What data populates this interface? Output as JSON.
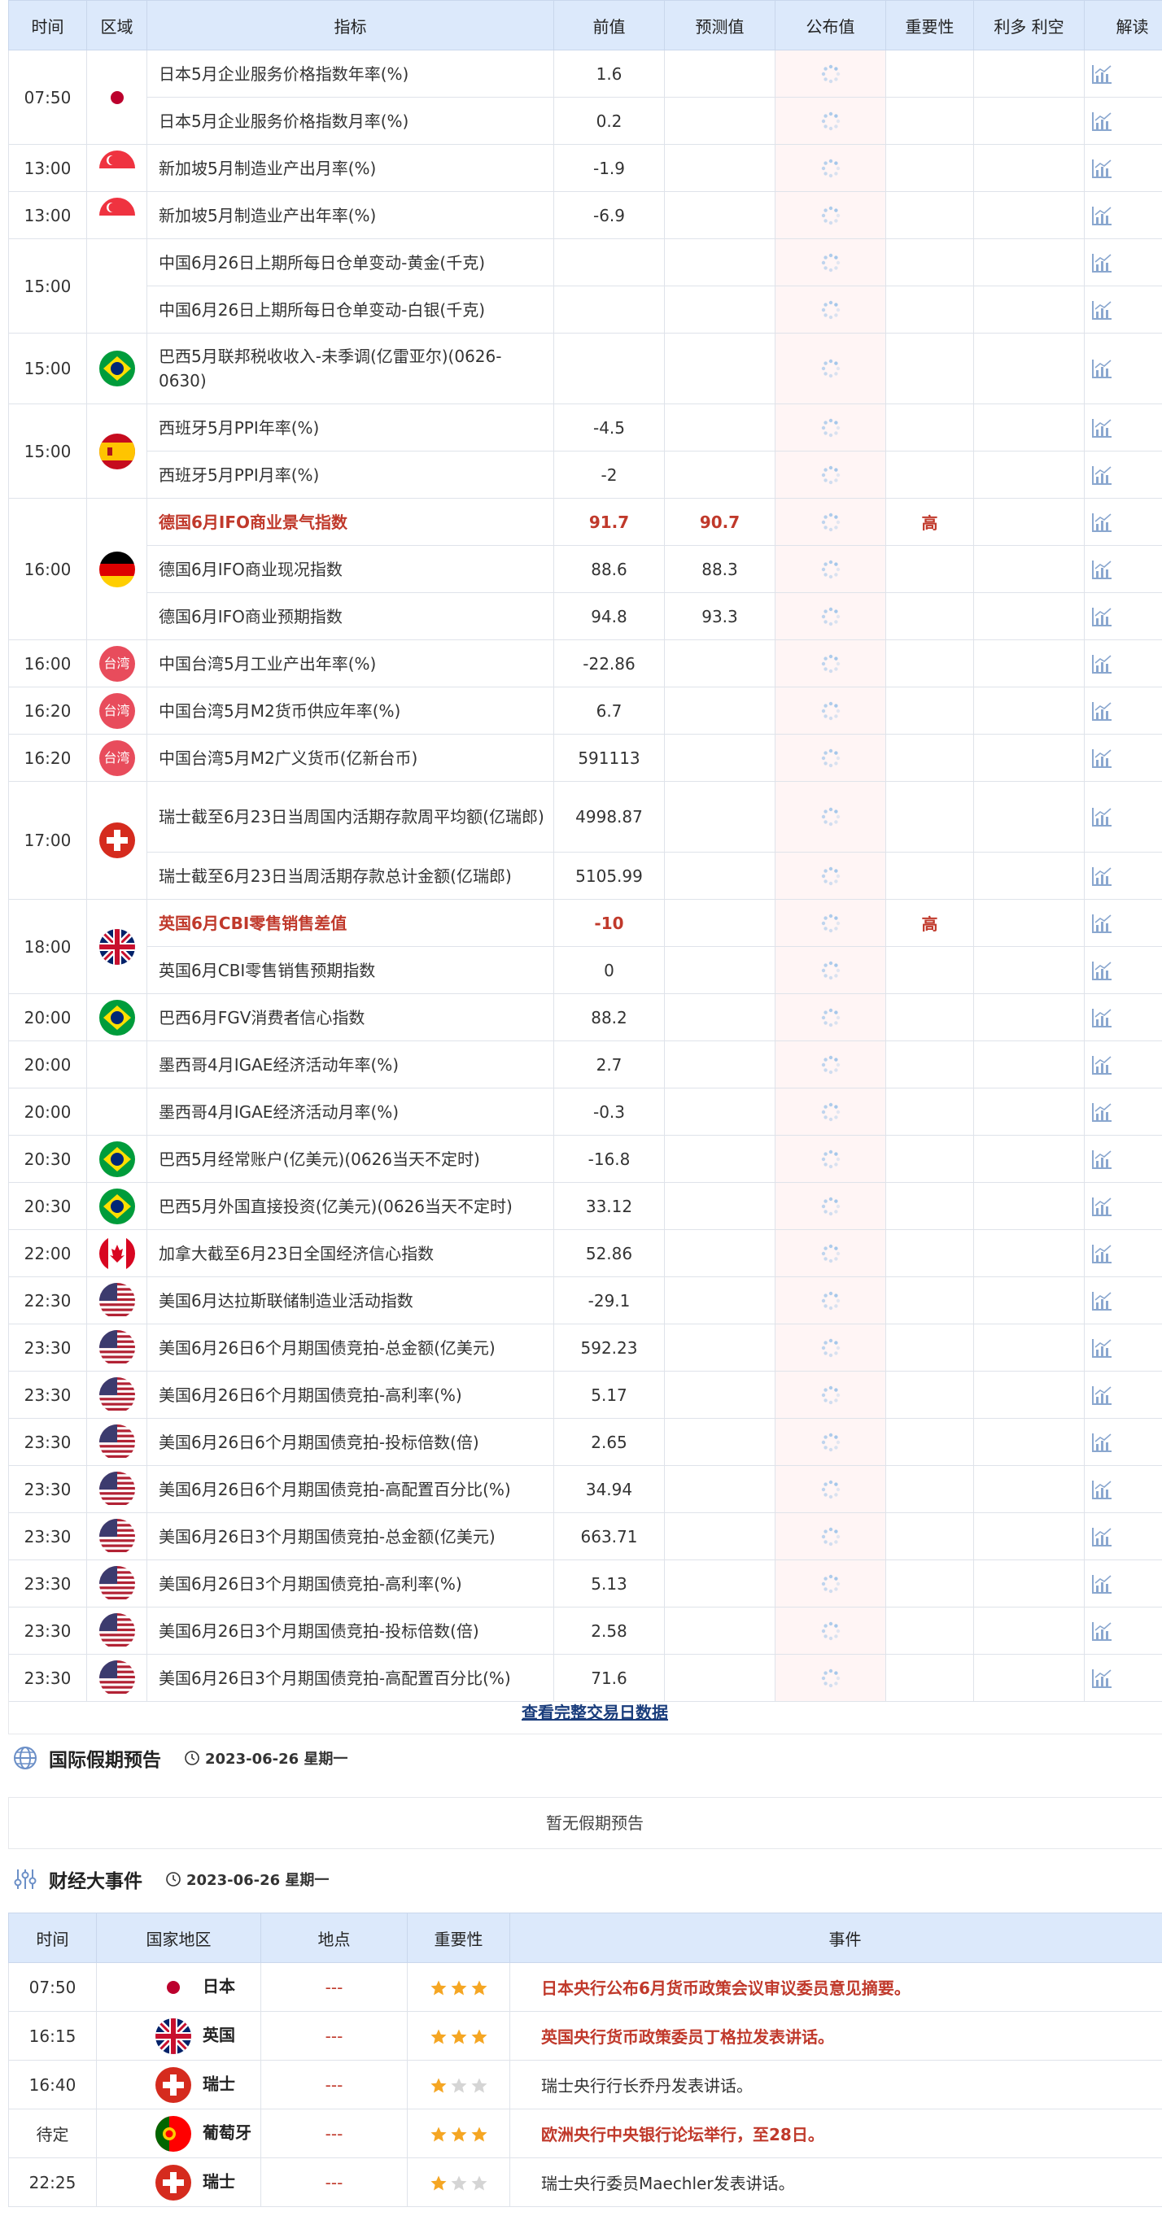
{
  "headers": {
    "time": "时间",
    "area": "区域",
    "indicator": "指标",
    "prev": "前值",
    "forecast": "预测值",
    "actual": "公布值",
    "importance": "重要性",
    "effect": "利多 利空",
    "explain": "解读"
  },
  "rows": [
    {
      "time": "07:50",
      "flag": "jp",
      "indicator": "日本5月企业服务价格指数年率(%)",
      "prev": "1.6",
      "forecast": "",
      "importance": "",
      "hl": false
    },
    {
      "time": "",
      "flag": "",
      "indicator": "日本5月企业服务价格指数月率(%)",
      "prev": "0.2",
      "forecast": "",
      "importance": "",
      "hl": false
    },
    {
      "time": "13:00",
      "flag": "sg",
      "indicator": "新加坡5月制造业产出月率(%)",
      "prev": "-1.9",
      "forecast": "",
      "importance": "",
      "hl": false
    },
    {
      "time": "13:00",
      "flag": "sg",
      "indicator": "新加坡5月制造业产出年率(%)",
      "prev": "-6.9",
      "forecast": "",
      "importance": "",
      "hl": false
    },
    {
      "time": "15:00",
      "flag": "none",
      "indicator": "中国6月26日上期所每日仓单变动-黄金(千克)",
      "prev": "",
      "forecast": "",
      "importance": "",
      "hl": false
    },
    {
      "time": "",
      "flag": "",
      "indicator": "中国6月26日上期所每日仓单变动-白银(千克)",
      "prev": "",
      "forecast": "",
      "importance": "",
      "hl": false
    },
    {
      "time": "15:00",
      "flag": "br",
      "indicator": "巴西5月联邦税收收入-未季调(亿雷亚尔)(0626-0630)",
      "prev": "",
      "forecast": "",
      "importance": "",
      "hl": false,
      "tall": true
    },
    {
      "time": "15:00",
      "flag": "es",
      "indicator": "西班牙5月PPI年率(%)",
      "prev": "-4.5",
      "forecast": "",
      "importance": "",
      "hl": false
    },
    {
      "time": "",
      "flag": "",
      "indicator": "西班牙5月PPI月率(%)",
      "prev": "-2",
      "forecast": "",
      "importance": "",
      "hl": false
    },
    {
      "time": "16:00",
      "flag": "de",
      "indicator": "德国6月IFO商业景气指数",
      "prev": "91.7",
      "forecast": "90.7",
      "importance": "高",
      "hl": true
    },
    {
      "time": "",
      "flag": "",
      "indicator": "德国6月IFO商业现况指数",
      "prev": "88.6",
      "forecast": "88.3",
      "importance": "",
      "hl": false
    },
    {
      "time": "",
      "flag": "",
      "indicator": "德国6月IFO商业预期指数",
      "prev": "94.8",
      "forecast": "93.3",
      "importance": "",
      "hl": false
    },
    {
      "time": "16:00",
      "flag": "tw",
      "indicator": "中国台湾5月工业产出年率(%)",
      "prev": "-22.86",
      "forecast": "",
      "importance": "",
      "hl": false
    },
    {
      "time": "16:20",
      "flag": "tw",
      "indicator": "中国台湾5月M2货币供应年率(%)",
      "prev": "6.7",
      "forecast": "",
      "importance": "",
      "hl": false
    },
    {
      "time": "16:20",
      "flag": "tw",
      "indicator": "中国台湾5月M2广义货币(亿新台币)",
      "prev": "591113",
      "forecast": "",
      "importance": "",
      "hl": false
    },
    {
      "time": "17:00",
      "flag": "ch",
      "indicator": "瑞士截至6月23日当周国内活期存款周平均额(亿瑞郎)",
      "prev": "4998.87",
      "forecast": "",
      "importance": "",
      "hl": false,
      "tall": true
    },
    {
      "time": "",
      "flag": "",
      "indicator": "瑞士截至6月23日当周活期存款总计金额(亿瑞郎)",
      "prev": "5105.99",
      "forecast": "",
      "importance": "",
      "hl": false
    },
    {
      "time": "18:00",
      "flag": "gb",
      "indicator": "英国6月CBI零售销售差值",
      "prev": "-10",
      "forecast": "",
      "importance": "高",
      "hl": true
    },
    {
      "time": "",
      "flag": "",
      "indicator": "英国6月CBI零售销售预期指数",
      "prev": "0",
      "forecast": "",
      "importance": "",
      "hl": false
    },
    {
      "time": "20:00",
      "flag": "br",
      "indicator": "巴西6月FGV消费者信心指数",
      "prev": "88.2",
      "forecast": "",
      "importance": "",
      "hl": false
    },
    {
      "time": "20:00",
      "flag": "none",
      "indicator": "墨西哥4月IGAE经济活动年率(%)",
      "prev": "2.7",
      "forecast": "",
      "importance": "",
      "hl": false
    },
    {
      "time": "20:00",
      "flag": "none",
      "indicator": "墨西哥4月IGAE经济活动月率(%)",
      "prev": "-0.3",
      "forecast": "",
      "importance": "",
      "hl": false
    },
    {
      "time": "20:30",
      "flag": "br",
      "indicator": "巴西5月经常账户(亿美元)(0626当天不定时)",
      "prev": "-16.8",
      "forecast": "",
      "importance": "",
      "hl": false
    },
    {
      "time": "20:30",
      "flag": "br",
      "indicator": "巴西5月外国直接投资(亿美元)(0626当天不定时)",
      "prev": "33.12",
      "forecast": "",
      "importance": "",
      "hl": false
    },
    {
      "time": "22:00",
      "flag": "ca",
      "indicator": "加拿大截至6月23日全国经济信心指数",
      "prev": "52.86",
      "forecast": "",
      "importance": "",
      "hl": false
    },
    {
      "time": "22:30",
      "flag": "us",
      "indicator": "美国6月达拉斯联储制造业活动指数",
      "prev": "-29.1",
      "forecast": "",
      "importance": "",
      "hl": false
    },
    {
      "time": "23:30",
      "flag": "us",
      "indicator": "美国6月26日6个月期国债竞拍-总金额(亿美元)",
      "prev": "592.23",
      "forecast": "",
      "importance": "",
      "hl": false
    },
    {
      "time": "23:30",
      "flag": "us",
      "indicator": "美国6月26日6个月期国债竞拍-高利率(%)",
      "prev": "5.17",
      "forecast": "",
      "importance": "",
      "hl": false
    },
    {
      "time": "23:30",
      "flag": "us",
      "indicator": "美国6月26日6个月期国债竞拍-投标倍数(倍)",
      "prev": "2.65",
      "forecast": "",
      "importance": "",
      "hl": false
    },
    {
      "time": "23:30",
      "flag": "us",
      "indicator": "美国6月26日6个月期国债竞拍-高配置百分比(%)",
      "prev": "34.94",
      "forecast": "",
      "importance": "",
      "hl": false
    },
    {
      "time": "23:30",
      "flag": "us",
      "indicator": "美国6月26日3个月期国债竞拍-总金额(亿美元)",
      "prev": "663.71",
      "forecast": "",
      "importance": "",
      "hl": false
    },
    {
      "time": "23:30",
      "flag": "us",
      "indicator": "美国6月26日3个月期国债竞拍-高利率(%)",
      "prev": "5.13",
      "forecast": "",
      "importance": "",
      "hl": false
    },
    {
      "time": "23:30",
      "flag": "us",
      "indicator": "美国6月26日3个月期国债竞拍-投标倍数(倍)",
      "prev": "2.58",
      "forecast": "",
      "importance": "",
      "hl": false
    },
    {
      "time": "23:30",
      "flag": "us",
      "indicator": "美国6月26日3个月期国债竞拍-高配置百分比(%)",
      "prev": "71.6",
      "forecast": "",
      "importance": "",
      "hl": false
    }
  ],
  "view_more": "查看完整交易日数据",
  "holiday": {
    "title": "国际假期预告",
    "date": "2023-06-26 星期一",
    "empty": "暂无假期预告"
  },
  "events": {
    "title": "财经大事件",
    "date": "2023-06-26 星期一",
    "headers": {
      "time": "时间",
      "country": "国家地区",
      "location": "地点",
      "importance": "重要性",
      "event": "事件"
    },
    "rows": [
      {
        "time": "07:50",
        "flag": "jp",
        "country": "日本",
        "location": "---",
        "stars": 3,
        "event": "日本央行公布6月货币政策会议审议委员意见摘要。",
        "hl": true
      },
      {
        "time": "16:15",
        "flag": "gb",
        "country": "英国",
        "location": "---",
        "stars": 3,
        "event": "英国央行货币政策委员丁格拉发表讲话。",
        "hl": true
      },
      {
        "time": "16:40",
        "flag": "ch",
        "country": "瑞士",
        "location": "---",
        "stars": 1,
        "event": "瑞士央行行长乔丹发表讲话。",
        "hl": false
      },
      {
        "time": "待定",
        "flag": "pt",
        "country": "葡萄牙",
        "location": "---",
        "stars": 3,
        "event": "欧洲央行中央银行论坛举行，至28日。",
        "hl": true
      },
      {
        "time": "22:25",
        "flag": "ch",
        "country": "瑞士",
        "location": "---",
        "stars": 1,
        "event": "瑞士央行委员Maechler发表讲话。",
        "hl": false
      }
    ]
  },
  "colors": {
    "header_bg": "#dce9fb",
    "highlight": "#c0392b",
    "star_on": "#f5a623",
    "star_off": "#d5d5d5"
  }
}
